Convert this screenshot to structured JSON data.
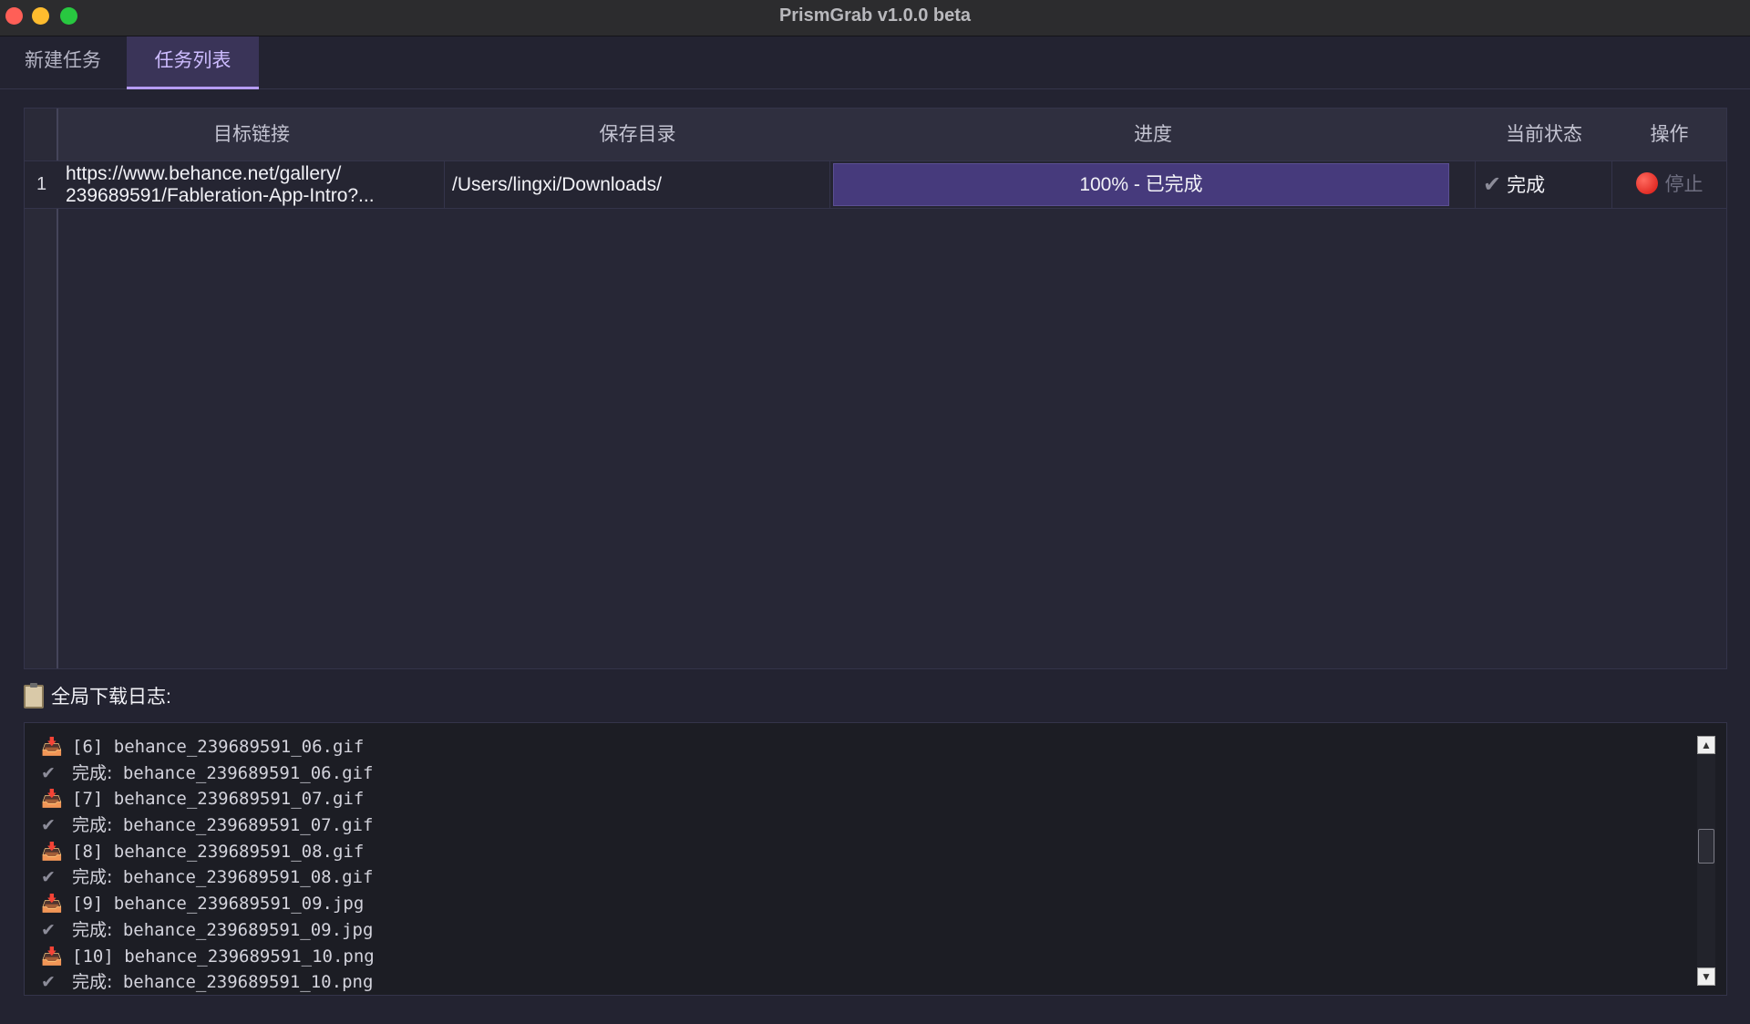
{
  "window": {
    "title": "PrismGrab v1.0.0 beta"
  },
  "tabs": [
    {
      "label": "新建任务",
      "active": false
    },
    {
      "label": "任务列表",
      "active": true
    }
  ],
  "table": {
    "columns": [
      "目标链接",
      "保存目录",
      "进度",
      "当前状态",
      "操作"
    ],
    "rows": [
      {
        "index": "1",
        "url_line1": "https://www.behance.net/gallery/",
        "url_line2": "239689591/Fableration-App-Intro?...",
        "save_dir": "/Users/lingxi/Downloads/",
        "progress_text": "100% - 已完成",
        "progress": 1.0,
        "status_icon": "check-icon",
        "status": "完成",
        "action_icon": "stop-icon",
        "action": "停止"
      }
    ]
  },
  "log": {
    "title": "全局下载日志:",
    "lines": [
      {
        "icon": "📥",
        "prefix": "",
        "text": "[6] behance_239689591_06.gif"
      },
      {
        "icon": "✔",
        "prefix": "完成:",
        "text": " behance_239689591_06.gif"
      },
      {
        "icon": "📥",
        "prefix": "",
        "text": "[7] behance_239689591_07.gif"
      },
      {
        "icon": "✔",
        "prefix": "完成:",
        "text": " behance_239689591_07.gif"
      },
      {
        "icon": "📥",
        "prefix": "",
        "text": "[8] behance_239689591_08.gif"
      },
      {
        "icon": "✔",
        "prefix": "完成:",
        "text": " behance_239689591_08.gif"
      },
      {
        "icon": "📥",
        "prefix": "",
        "text": "[9] behance_239689591_09.jpg"
      },
      {
        "icon": "✔",
        "prefix": "完成:",
        "text": " behance_239689591_09.jpg"
      },
      {
        "icon": "📥",
        "prefix": "",
        "text": "[10] behance_239689591_10.png"
      },
      {
        "icon": "✔",
        "prefix": "完成:",
        "text": " behance_239689591_10.png"
      }
    ]
  },
  "colors": {
    "accent": "#b69cff",
    "progress_fill": "#463a7c",
    "stop_red": "#e0241c"
  }
}
